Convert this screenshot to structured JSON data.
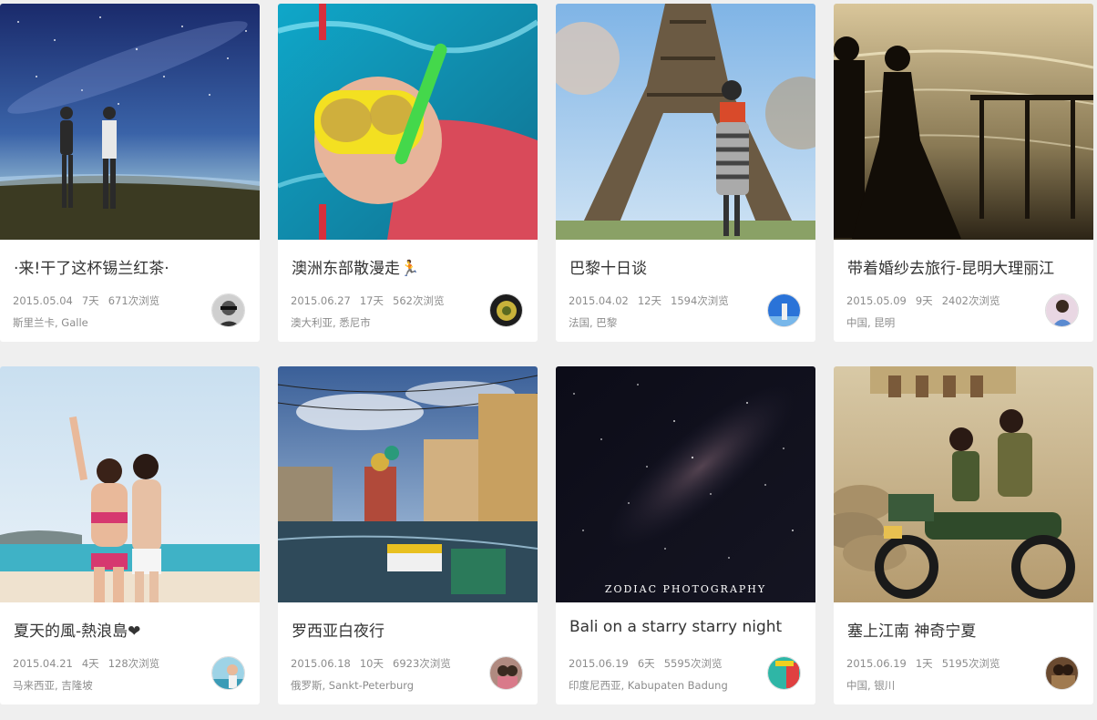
{
  "cards": [
    {
      "title": "·来!干了这杯锡兰红茶·",
      "date": "2015.05.04",
      "days": "7天",
      "views": "671次浏览",
      "location": "斯里兰卡, Galle",
      "photo_desc": "starry-night-two-travelers"
    },
    {
      "title": "澳洲东部散漫走🏃",
      "date": "2015.06.27",
      "days": "17天",
      "views": "562次浏览",
      "location": "澳大利亚, 悉尼市",
      "photo_desc": "snorkeling-selfie"
    },
    {
      "title": "巴黎十日谈",
      "date": "2015.04.02",
      "days": "12天",
      "views": "1594次浏览",
      "location": "法国, 巴黎",
      "photo_desc": "eiffel-tower-woman"
    },
    {
      "title": "带着婚纱去旅行-昆明大理丽江",
      "date": "2015.05.09",
      "days": "9天",
      "views": "2402次浏览",
      "location": "中国, 昆明",
      "photo_desc": "wedding-silhouette-lake"
    },
    {
      "title": "夏天的風-熱浪島❤",
      "date": "2015.04.21",
      "days": "4天",
      "views": "128次浏览",
      "location": "马来西亚, 吉隆坡",
      "photo_desc": "beach-two-women"
    },
    {
      "title": "罗西亚白夜行",
      "date": "2015.06.18",
      "days": "10天",
      "views": "6923次浏览",
      "location": "俄罗斯, Sankt-Peterburg",
      "photo_desc": "saint-petersburg-canal"
    },
    {
      "title": "Bali on a starry starry night",
      "date": "2015.06.19",
      "days": "6天",
      "views": "5595次浏览",
      "location": "印度尼西亚, Kabupaten Badung",
      "photo_desc": "milky-way-sky",
      "photo_caption": "ZODIAC PHOTOGRAPHY"
    },
    {
      "title": "塞上江南 神奇宁夏",
      "date": "2015.06.19",
      "days": "1天",
      "views": "5195次浏览",
      "location": "中国, 银川",
      "photo_desc": "couple-on-motorcycle"
    }
  ]
}
